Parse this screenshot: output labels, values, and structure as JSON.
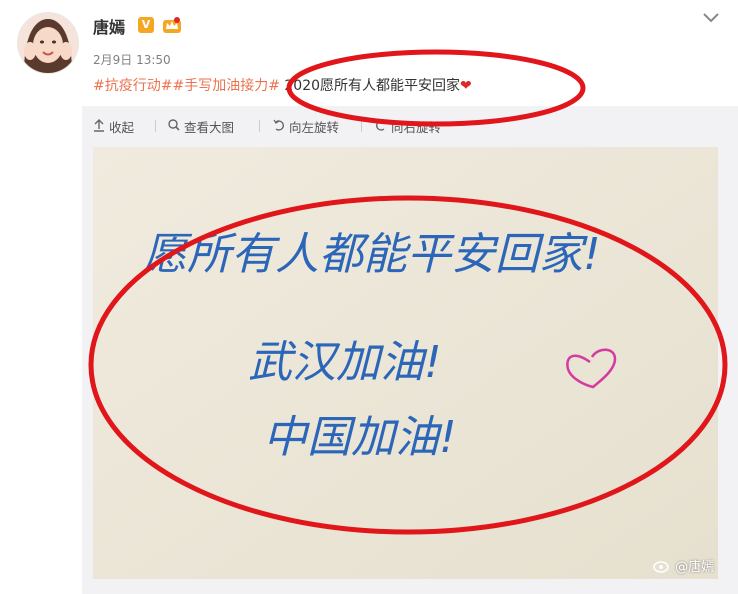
{
  "post": {
    "username": "唐嫣",
    "verified_badge": "V",
    "timestamp": "2月9日 13:50",
    "hashtags": [
      "#抗疫行动#",
      "#手写加油接力#"
    ],
    "message": " 2020愿所有人都能平安回家",
    "emoji": "❤"
  },
  "toolbar": {
    "collapse": "收起",
    "view_large": "查看大图",
    "rotate_left": "向左旋转",
    "rotate_right": "向右旋转"
  },
  "photo": {
    "handwriting_lines": [
      "愿所有人都能平安回家!",
      "武汉加油!",
      "中国加油!"
    ],
    "watermark": "@唐嫣"
  },
  "colors": {
    "tag": "#eb7350",
    "ink": "#2b66b8",
    "annotation_red": "#e0161b",
    "heart_doodle": "#d63aa0"
  },
  "icons": [
    "chevron-down-icon",
    "collapse-icon",
    "zoom-icon",
    "rotate-left-icon",
    "rotate-right-icon",
    "weibo-logo-icon"
  ]
}
